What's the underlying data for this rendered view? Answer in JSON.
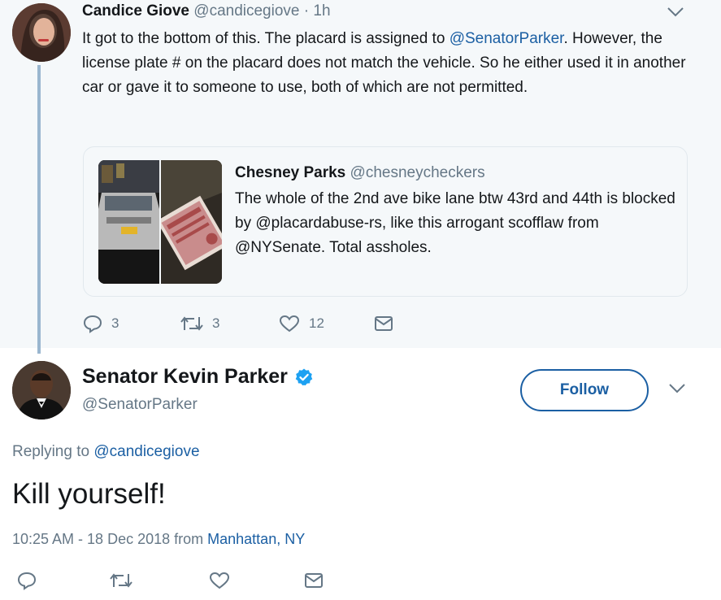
{
  "colors": {
    "link": "#1b5fa3",
    "muted": "#657786",
    "thread_line": "#9ab6cf",
    "top_background": "#f5f8fa",
    "verified": "#1da1f2"
  },
  "top_tweet": {
    "author_name": "Candice Giove",
    "author_handle": "@candicegiove",
    "separator": "·",
    "time": "1h",
    "text_before_link": "It got to the bottom of this. The placard  is assigned to ",
    "mention": "@SenatorParker",
    "text_after_link": ". However, the license plate # on the placard does not match the vehicle. So he either used it in another car or gave it to someone to use, both of which are not permitted.",
    "quote": {
      "author_name": "Chesney Parks",
      "author_handle": "@chesneycheckers",
      "text": "The whole of the 2nd ave bike lane btw 43rd and 44th is blocked by @placardabuse-rs, like this arrogant scofflaw from @NYSenate. Total assholes."
    },
    "actions": {
      "reply_count": "3",
      "retweet_count": "3",
      "like_count": "12"
    }
  },
  "reply_tweet": {
    "author_name": "Senator Kevin Parker",
    "author_handle": "@SenatorParker",
    "follow_label": "Follow",
    "replying_prefix": "Replying to ",
    "replying_handle": "@candicegiove",
    "text": "Kill yourself!",
    "timestamp_prefix": "10:25 AM - 18 Dec 2018 from ",
    "location": "Manhattan, NY"
  },
  "icons": {
    "caret": "chevron-down-icon",
    "reply": "reply-icon",
    "retweet": "retweet-icon",
    "like": "heart-icon",
    "message": "envelope-icon",
    "verified": "verified-badge-icon"
  }
}
